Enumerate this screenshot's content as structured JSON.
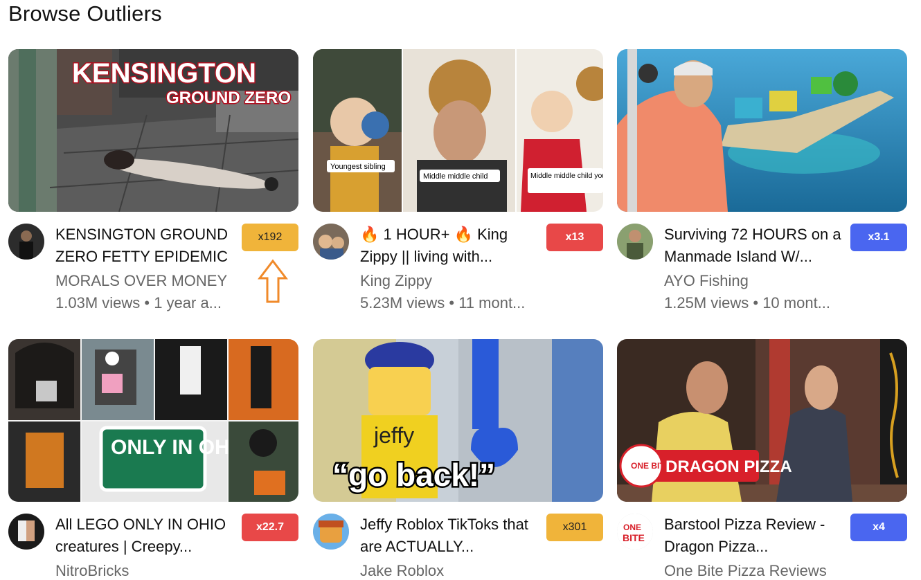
{
  "page_title": "Browse Outliers",
  "videos": [
    {
      "title": "KENSINGTON GROUND ZERO FETTY EPIDEMIC",
      "channel": "MORALS OVER MONEY",
      "meta": "1.03M views • 1 year a...",
      "multiplier": "x192",
      "badge_color": "#f0b43a",
      "thumb_text": "KENSINGTON",
      "thumb_subtext": "GROUND ZERO"
    },
    {
      "title": "🔥 1 HOUR+ 🔥 King Zippy || living with...",
      "channel": "King Zippy",
      "meta": "5.23M views • 11 mont...",
      "multiplier": "x13",
      "badge_color": "#e84848",
      "thumb_labels": [
        "Youngest sibling",
        "Middle middle child",
        "Middle middle child youngest"
      ]
    },
    {
      "title": "Surviving 72 HOURS on a Manmade Island W/...",
      "channel": "AYO Fishing",
      "meta": "1.25M views • 10 mont...",
      "multiplier": "x3.1",
      "badge_color": "#4a66f0"
    },
    {
      "title": "All LEGO ONLY IN OHIO creatures | Creepy...",
      "channel": "NitroBricks",
      "meta": "",
      "multiplier": "x22.7",
      "badge_color": "#e84848",
      "thumb_text": "ONLY IN OHIO"
    },
    {
      "title": "Jeffy Roblox TikToks that are ACTUALLY...",
      "channel": "Jake Roblox",
      "meta": "",
      "multiplier": "x301",
      "badge_color": "#f0b43a",
      "thumb_text": "“go back!”",
      "thumb_subtext": "jeffy"
    },
    {
      "title": "Barstool Pizza Review - Dragon Pizza...",
      "channel": "One Bite Pizza Reviews",
      "meta": "",
      "multiplier": "x4",
      "badge_color": "#4a66f0",
      "thumb_text": "DRAGON PIZZA",
      "thumb_subtext": "ONE BITE"
    }
  ],
  "annotation": {
    "icon": "up-arrow-icon",
    "color": "#f08a2a"
  }
}
